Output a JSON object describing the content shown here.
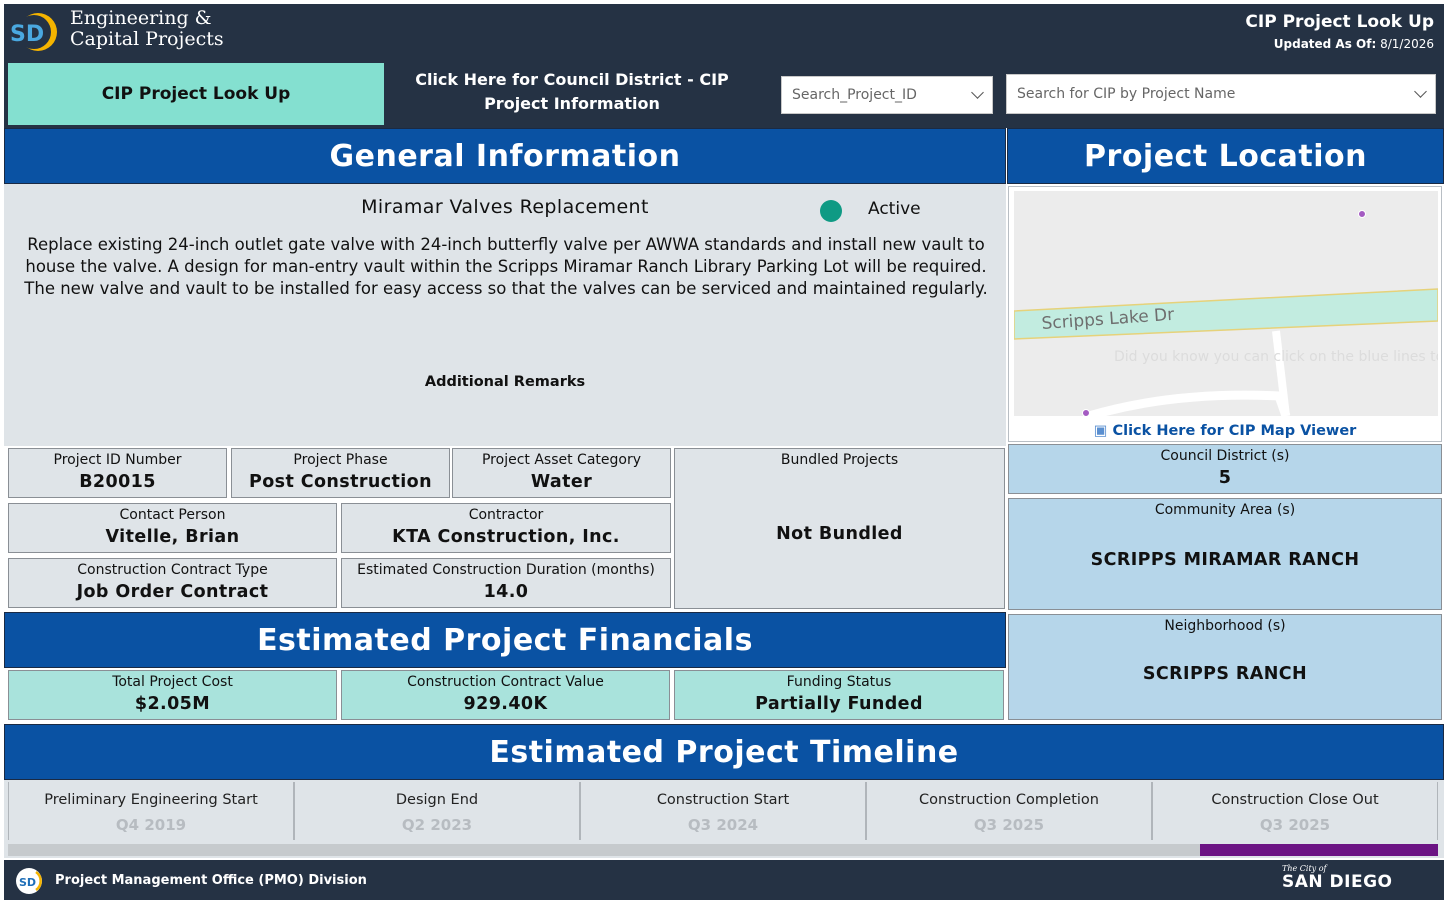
{
  "header": {
    "brand_line1": "Engineering &",
    "brand_line2": "Capital Projects",
    "logo_text": "SD",
    "title": "CIP Project Look Up",
    "updated_label": "Updated As Of:",
    "updated_value": "8/1/2026"
  },
  "nav": {
    "lookup_tab": "CIP Project Look Up",
    "council_tab": "Click Here for Council District - CIP Project Information",
    "search_id_placeholder": "Search_Project_ID",
    "search_name_placeholder": "Search for CIP by Project Name"
  },
  "sections": {
    "general": "General Information",
    "location": "Project Location",
    "financials": "Estimated Project Financials",
    "timeline": "Estimated Project Timeline"
  },
  "project": {
    "name": "Miramar Valves Replacement",
    "status": "Active",
    "status_color": "#0f9a84",
    "description": "Replace existing 24-inch outlet gate valve with 24-inch butterfly valve per AWWA standards and install new vault to house the valve. A design for man-entry vault within the Scripps Miramar Ranch Library Parking Lot will be required. The new valve and vault to be installed for easy access so that the valves can be serviced and maintained regularly.",
    "remarks_label": "Additional Remarks"
  },
  "details": {
    "id_label": "Project ID Number",
    "id_value": "B20015",
    "phase_label": "Project Phase",
    "phase_value": "Post Construction",
    "asset_label": "Project Asset Category",
    "asset_value": "Water",
    "bundled_label": "Bundled Projects",
    "bundled_value": "Not Bundled",
    "contact_label": "Contact Person",
    "contact_value": "Vitelle, Brian",
    "contractor_label": "Contractor",
    "contractor_value": "KTA Construction, Inc.",
    "contract_type_label": "Construction Contract Type",
    "contract_type_value": "Job Order Contract",
    "duration_label": "Estimated Construction Duration (months)",
    "duration_value": "14.0"
  },
  "location": {
    "street_label": "Scripps Lake Dr",
    "watermark": "Did you know you can click on the blue lines to enter Streetside?",
    "map_link": "Click Here for CIP Map Viewer",
    "council_label": "Council District (s)",
    "council_value": "5",
    "community_label": "Community Area (s)",
    "community_value": "SCRIPPS MIRAMAR RANCH",
    "neighborhood_label": "Neighborhood (s)",
    "neighborhood_value": "SCRIPPS RANCH"
  },
  "financials": {
    "total_label": "Total Project Cost",
    "total_value": "$2.05M",
    "contract_label": "Construction Contract Value",
    "contract_value": "929.40K",
    "funding_label": "Funding Status",
    "funding_value": "Partially Funded"
  },
  "timeline": [
    {
      "label": "Preliminary Engineering Start",
      "value": "Q4 2019"
    },
    {
      "label": "Design End",
      "value": "Q2 2023"
    },
    {
      "label": "Construction Start",
      "value": "Q3 2024"
    },
    {
      "label": "Construction Completion",
      "value": "Q3 2025"
    },
    {
      "label": "Construction Close Out",
      "value": "Q3 2025"
    }
  ],
  "footer": {
    "division": "Project Management Office (PMO) Division",
    "city_small": "The City of",
    "city_big": "SAN DIEGO"
  },
  "colors": {
    "header_bg": "#253244",
    "section_blue": "#0a52a3",
    "tab_teal": "#84e0d0",
    "scroll_thumb": "#6c1484"
  }
}
